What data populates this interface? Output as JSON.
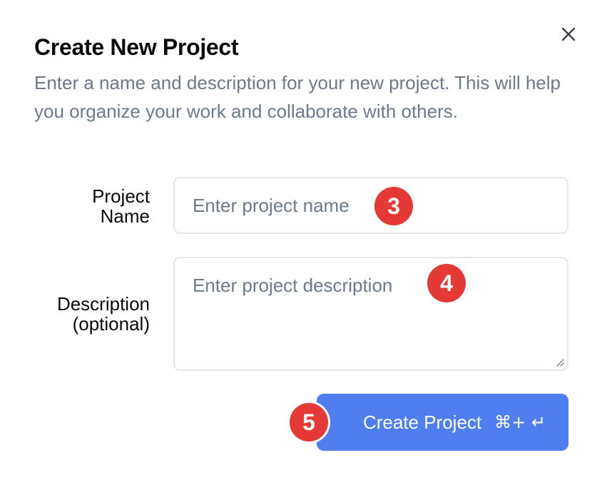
{
  "dialog": {
    "title": "Create New Project",
    "description": "Enter a name and description for your new project. This will help you organize your work and collaborate with others.",
    "close_icon": "close-icon"
  },
  "form": {
    "name_label": "Project Name",
    "name_placeholder": "Enter project name",
    "description_label": "Description (optional)",
    "description_placeholder": "Enter project description"
  },
  "submit": {
    "label": "Create Project",
    "shortcut": "⌘+ ↵"
  },
  "annotations": {
    "name_badge": "3",
    "description_badge": "4",
    "submit_badge": "5"
  },
  "colors": {
    "primary": "#4f7ef0",
    "badge": "#e53935",
    "muted_text": "#6b7a8c",
    "border": "#e3e6ee"
  }
}
